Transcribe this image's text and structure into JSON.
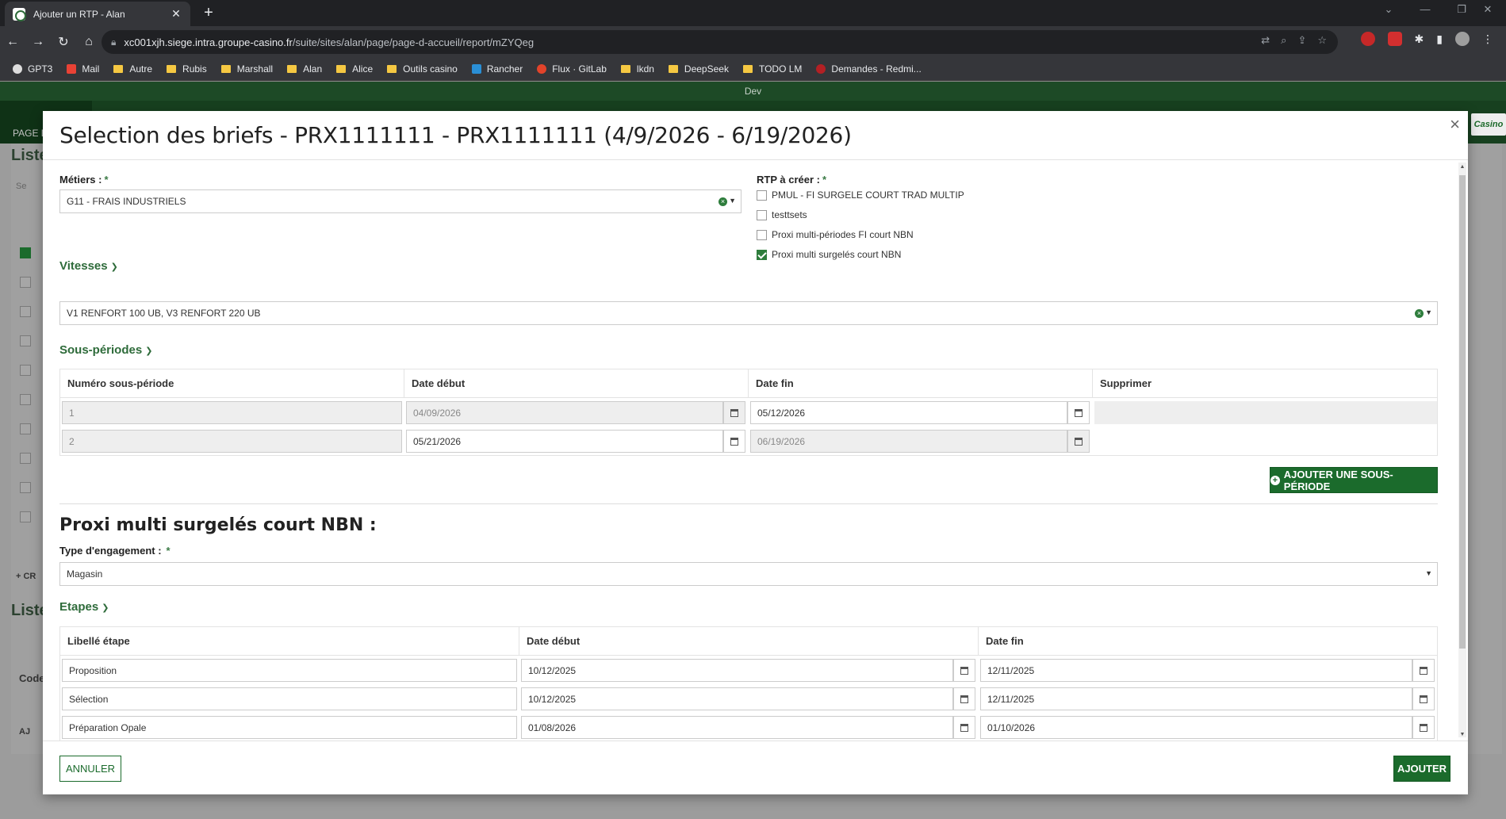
{
  "browser": {
    "tab_title": "Ajouter un RTP - Alan",
    "tab_close": "✕",
    "new_tab": "+",
    "url_host": "xc001xjh.siege.intra.groupe-casino.fr",
    "url_path": "/suite/sites/alan/page/page-d-accueil/report/mZYQeg",
    "bookmarks": [
      "GPT3",
      "Mail",
      "Autre",
      "Rubis",
      "Marshall",
      "Alan",
      "Alice",
      "Outils casino",
      "Rancher",
      "Flux · GitLab",
      "lkdn",
      "DeepSeek",
      "TODO LM",
      "Demandes - Redmi..."
    ]
  },
  "app": {
    "env_label": "Dev",
    "page_tab": "PAGE D",
    "logo": "Casino",
    "bg_titles": [
      "Liste",
      "Liste"
    ],
    "bg_search": "Se",
    "bg_create": "+ CR",
    "bg_code": "Code",
    "bg_add": "AJ"
  },
  "modal": {
    "title": "Selection des briefs - PRX1111111 - PRX1111111 (4/9/2026 - 6/19/2026)",
    "close": "×",
    "metiers_label": "Métiers :",
    "metiers_value": "G11 - FRAIS INDUSTRIELS",
    "required": "*",
    "rtp_label": "RTP à créer :",
    "rtp_options": [
      {
        "label": "PMUL - FI SURGELE COURT TRAD MULTIP",
        "checked": false
      },
      {
        "label": "testtsets",
        "checked": false
      },
      {
        "label": "Proxi multi-périodes FI court NBN",
        "checked": false
      },
      {
        "label": "Proxi multi surgelés court NBN",
        "checked": true
      }
    ],
    "vitesses_label": "Vitesses",
    "vitesses_value": "V1 RENFORT 100 UB, V3 RENFORT 220 UB",
    "sous_periodes_label": "Sous-périodes",
    "sp_headers": [
      "Numéro sous-période",
      "Date début",
      "Date fin",
      "Supprimer"
    ],
    "sp_rows": [
      {
        "num": "1",
        "debut": "04/09/2026",
        "fin": "05/12/2026"
      },
      {
        "num": "2",
        "debut": "05/21/2026",
        "fin": "06/19/2026"
      }
    ],
    "add_sp_button": "AJOUTER UNE SOUS-PÉRIODE",
    "rtp_section_title": "Proxi multi surgelés court NBN :",
    "engagement_label": "Type d'engagement :",
    "engagement_value": "Magasin",
    "etapes_label": "Etapes",
    "etapes_headers": [
      "Libellé étape",
      "Date début",
      "Date fin"
    ],
    "etapes_rows": [
      {
        "libelle": "Proposition",
        "debut": "10/12/2025",
        "fin": "12/11/2025"
      },
      {
        "libelle": "Sélection",
        "debut": "10/12/2025",
        "fin": "12/11/2025"
      },
      {
        "libelle": "Préparation Opale",
        "debut": "01/08/2026",
        "fin": "01/10/2026"
      }
    ],
    "cancel_button": "ANNULER",
    "add_button": "AJOUTER"
  },
  "colors": {
    "accent_green": "#1b6b2c",
    "env_bar": "#1d4a26"
  }
}
